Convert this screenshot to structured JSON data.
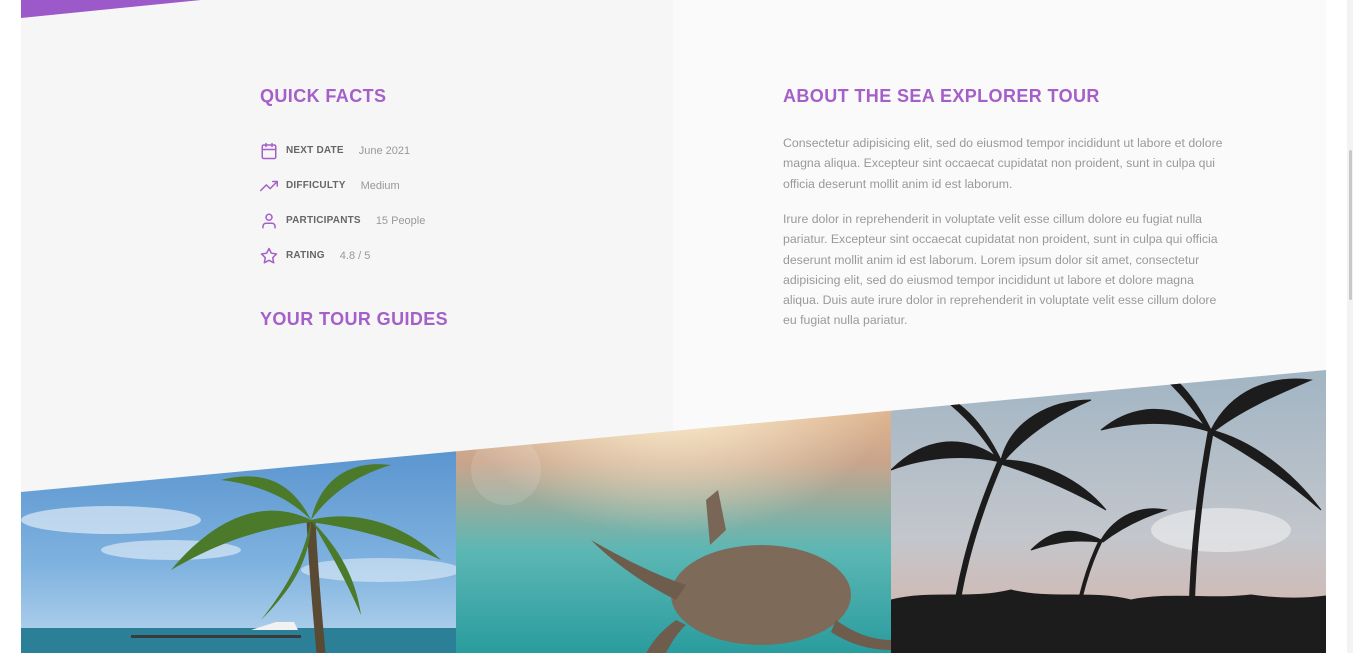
{
  "quick_facts": {
    "title": "QUICK FACTS",
    "items": [
      {
        "icon": "calendar-icon",
        "label": "NEXT DATE",
        "value": "June 2021"
      },
      {
        "icon": "trending-up-icon",
        "label": "DIFFICULTY",
        "value": "Medium"
      },
      {
        "icon": "user-icon",
        "label": "PARTICIPANTS",
        "value": "15 People"
      },
      {
        "icon": "star-icon",
        "label": "RATING",
        "value": "4.8 / 5"
      }
    ]
  },
  "guides": {
    "title": "YOUR TOUR GUIDES"
  },
  "about": {
    "title": "ABOUT THE SEA EXPLORER TOUR",
    "paragraph1": "Consectetur adipisicing elit, sed do eiusmod tempor incididunt ut labore et dolore magna aliqua. Excepteur sint occaecat cupidatat non proident, sunt in culpa qui officia deserunt mollit anim id est laborum.",
    "paragraph2": "Irure dolor in reprehenderit in voluptate velit esse cillum dolore eu fugiat nulla pariatur. Excepteur sint occaecat cupidatat non proident, sunt in culpa qui officia deserunt mollit anim id est laborum. Lorem ipsum dolor sit amet, consectetur adipisicing elit, sed do eiusmod tempor incididunt ut labore et dolore magna aliqua. Duis aute irure dolor in reprehenderit in voluptate velit esse cillum dolore eu fugiat nulla pariatur."
  },
  "colors": {
    "accent": "#a55fc8",
    "text": "#999999",
    "label": "#666666"
  },
  "gallery": {
    "photos": [
      {
        "name": "palm-beach-photo",
        "subject": "palm tree on a beach with a pier and boat"
      },
      {
        "name": "sea-turtle-photo",
        "subject": "sea turtle swimming underwater"
      },
      {
        "name": "palm-silhouettes-photo",
        "subject": "silhouetted palm trees against sunset sky"
      }
    ]
  }
}
